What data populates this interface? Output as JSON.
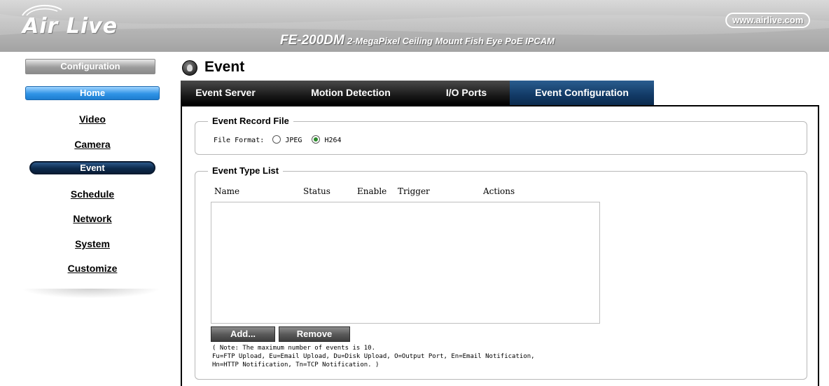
{
  "header": {
    "logo": "Air Live",
    "model": "FE-200DM",
    "model_desc": "2-MegaPixel Ceiling Mount Fish Eye PoE IPCAM",
    "site_link": "www.airlive.com"
  },
  "sidebar": {
    "config_label": "Configuration",
    "home_label": "Home",
    "items": [
      {
        "label": "Video"
      },
      {
        "label": "Camera"
      },
      {
        "label": "Event",
        "active": true
      },
      {
        "label": "Schedule"
      },
      {
        "label": "Network"
      },
      {
        "label": "System"
      },
      {
        "label": "Customize"
      }
    ]
  },
  "page": {
    "title": "Event"
  },
  "tabs": [
    {
      "label": "Event Server"
    },
    {
      "label": "Motion Detection"
    },
    {
      "label": "I/O Ports"
    },
    {
      "label": "Event Configuration",
      "active": true
    }
  ],
  "record_file": {
    "legend": "Event Record File",
    "format_label": "File Format:",
    "options": [
      {
        "label": "JPEG",
        "checked": false
      },
      {
        "label": "H264",
        "checked": true
      }
    ]
  },
  "event_list": {
    "legend": "Event Type List",
    "columns": [
      "Name",
      "Status",
      "Enable",
      "Trigger",
      "Actions"
    ],
    "rows": [],
    "add_label": "Add...",
    "remove_label": "Remove",
    "note_lines": [
      "( Note: The maximum number of events is 10.",
      " Fu=FTP Upload, Eu=Email Upload, Du=Disk Upload, O=Output Port, En=Email Notification,",
      "Hn=HTTP Notification, Tn=TCP Notification. )"
    ]
  },
  "colors": {
    "home_button": "#2f93e6",
    "active_nav": "#0c2a4c",
    "active_tab": "#123a66",
    "tab_bar": "#1a1a1a"
  }
}
